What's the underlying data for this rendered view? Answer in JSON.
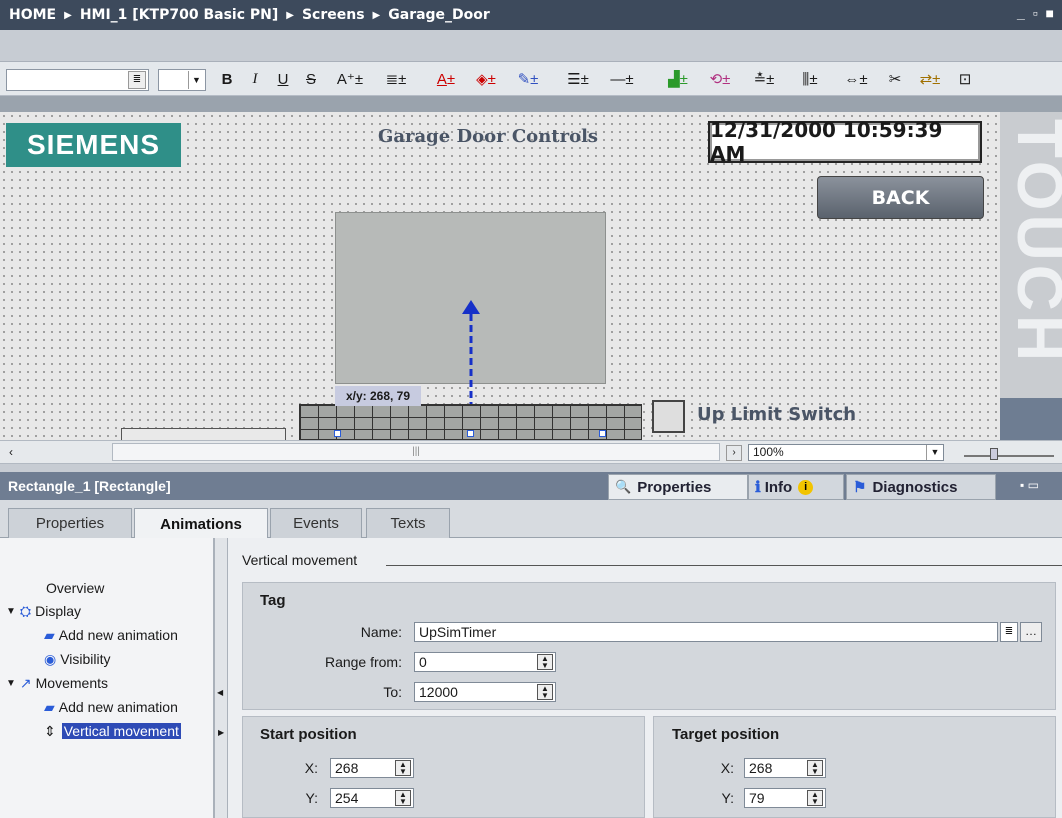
{
  "breadcrumb": [
    "HOME",
    "HMI_1 [KTP700 Basic PN]",
    "Screens",
    "Garage_Door"
  ],
  "window_controls": "_ ▫ ■",
  "toolbar": {
    "font_name": "",
    "font_size": "",
    "bold": "B",
    "italic": "I",
    "underline": "U",
    "strike": "S"
  },
  "screen": {
    "logo": "SIEMENS",
    "title": "Garage Door Controls",
    "datetime": "12/31/2000 10:59:39 AM",
    "back_button": "BACK",
    "brand_strip": "TOUCH",
    "coord_tooltip": "x/y: 268, 79",
    "up_limit_label": "Up Limit Switch"
  },
  "zoom": {
    "value": "100%"
  },
  "inspector": {
    "title": "Rectangle_1 [Rectangle]",
    "tabs": [
      {
        "label": "Properties",
        "icon": "properties-icon"
      },
      {
        "label": "Info",
        "icon": "info-icon"
      },
      {
        "label": "Diagnostics",
        "icon": "diagnostics-icon"
      }
    ],
    "subtabs": [
      "Properties",
      "Animations",
      "Events",
      "Texts"
    ],
    "active_subtab": "Animations"
  },
  "nav": {
    "overview": "Overview",
    "display": "Display",
    "display_add": "Add new animation",
    "visibility": "Visibility",
    "movements": "Movements",
    "movements_add": "Add new animation",
    "vertical": "Vertical movement"
  },
  "panel": {
    "section_title": "Vertical movement",
    "tag_group": "Tag",
    "name_label": "Name:",
    "name_value": "UpSimTimer",
    "range_from_label": "Range from:",
    "range_from_value": "0",
    "to_label": "To:",
    "to_value": "12000",
    "start_group": "Start position",
    "target_group": "Target position",
    "x_label": "X:",
    "y_label": "Y:",
    "start_x": "268",
    "start_y": "254",
    "target_x": "268",
    "target_y": "79"
  },
  "colors": {
    "siemens_teal": "#2f8f88",
    "selection_blue": "#2e4bb6",
    "title_bar": "#3d4a5c",
    "inspector_bar": "#6f7d92"
  }
}
